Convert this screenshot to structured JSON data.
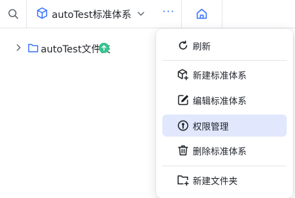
{
  "toolbar": {
    "system_title": "autoTest标准体系",
    "more_label": "···"
  },
  "tree": {
    "folder_label": "autoTest文件夹"
  },
  "menu": {
    "items": [
      {
        "label": "刷新",
        "icon": "refresh-icon"
      },
      {
        "label": "新建标准体系",
        "icon": "cube-plus-icon"
      },
      {
        "label": "编辑标准体系",
        "icon": "edit-icon"
      },
      {
        "label": "权限管理",
        "icon": "key-icon",
        "active": true
      },
      {
        "label": "删除标准体系",
        "icon": "trash-icon"
      },
      {
        "label": "新建文件夹",
        "icon": "folder-plus-icon"
      }
    ]
  },
  "colors": {
    "accent": "#3370ff",
    "active_bg": "#e1e8fd",
    "badge": "#34c38f",
    "text": "#1f2329",
    "border": "#e5e6eb"
  }
}
